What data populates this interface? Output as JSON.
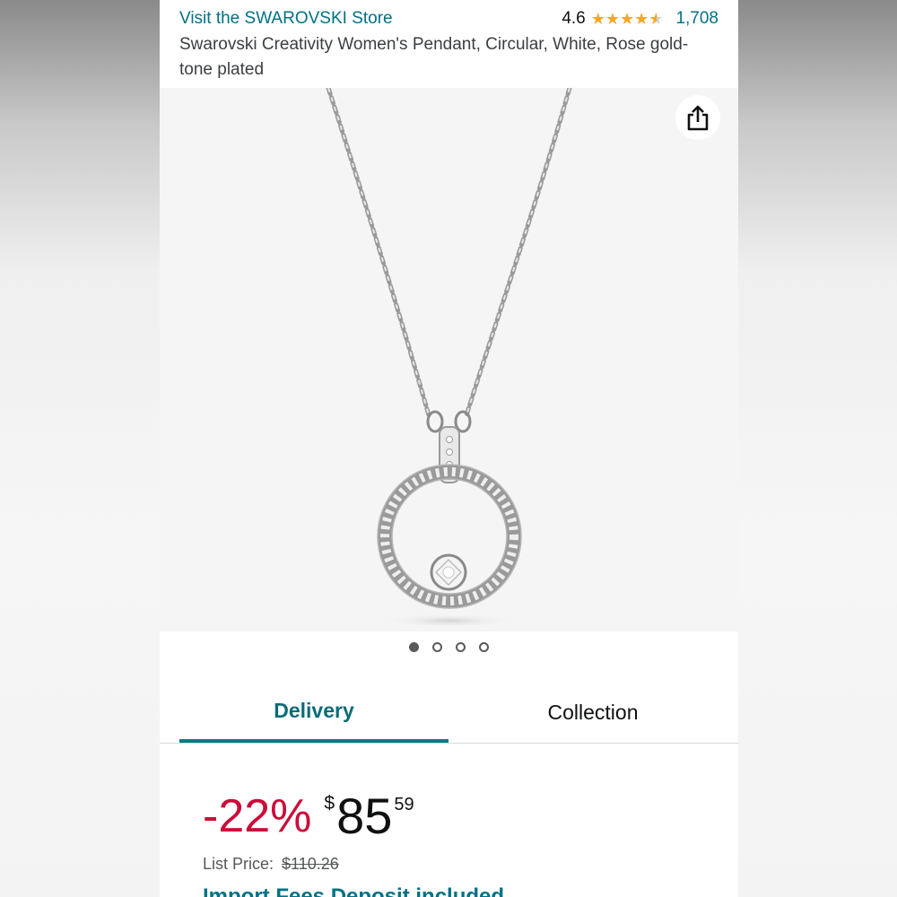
{
  "header": {
    "store_link": "Visit the SWAROVSKI Store",
    "rating_value": "4.6",
    "rating_stars": 4.6,
    "rating_count": "1,708",
    "product_title": "Swarovski Creativity Women's Pendant, Circular, White, Rose gold-tone plated"
  },
  "gallery": {
    "image_count": 4,
    "active_index": 0,
    "share_icon": "share-icon"
  },
  "tabs": [
    {
      "label": "Delivery",
      "active": true
    },
    {
      "label": "Collection",
      "active": false
    }
  ],
  "price": {
    "discount": "-22%",
    "currency": "$",
    "whole": "85",
    "fraction": "59",
    "list_price_label": "List Price:",
    "list_price_value": "$110.26"
  },
  "bottom_text": "Import Fees Deposit included",
  "colors": {
    "link": "#007185",
    "discount": "#cc0c39",
    "star": "#f5a623",
    "tab_active": "#0b7a88"
  }
}
